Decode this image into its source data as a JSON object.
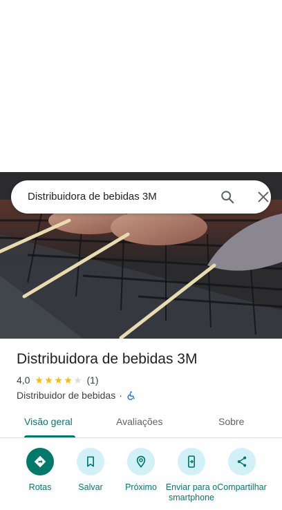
{
  "search": {
    "query": "Distribuidora de bebidas 3M"
  },
  "place": {
    "name": "Distribuidora de bebidas 3M",
    "rating_value": "4,0",
    "rating_stars": 4,
    "review_count": "(1)",
    "category": "Distribuidor de bebidas",
    "separator": "·"
  },
  "tabs": [
    {
      "label": "Visão geral",
      "active": true
    },
    {
      "label": "Avaliações",
      "active": false
    },
    {
      "label": "Sobre",
      "active": false
    }
  ],
  "actions": [
    {
      "label": "Rotas",
      "icon": "directions-icon"
    },
    {
      "label": "Salvar",
      "icon": "bookmark-icon"
    },
    {
      "label": "Próximo",
      "icon": "nearby-icon"
    },
    {
      "label": "Enviar para o smartphone",
      "icon": "send-to-phone-icon"
    },
    {
      "label": "Compartilhar",
      "icon": "share-icon"
    }
  ],
  "colors": {
    "accent": "#00796b",
    "action_bg": "#d2f1f7",
    "star": "#fbbc04"
  }
}
